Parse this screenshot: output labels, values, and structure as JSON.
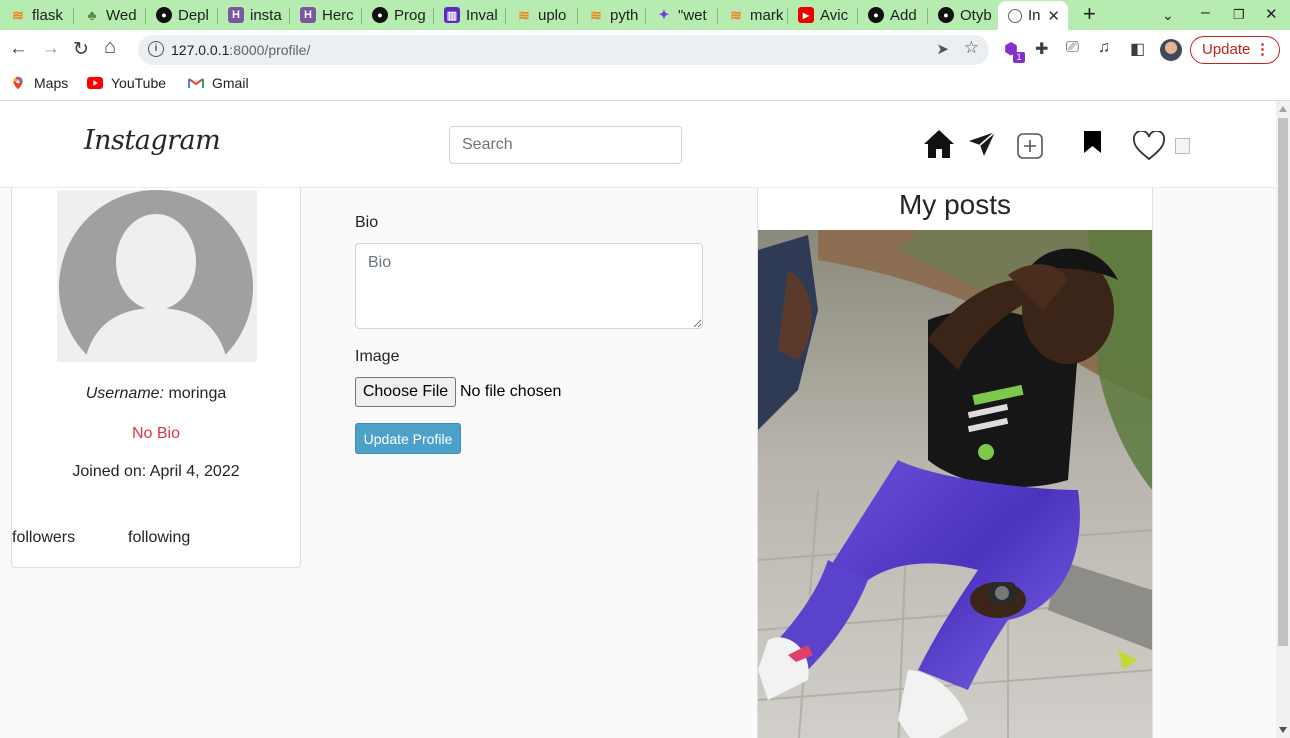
{
  "browser": {
    "tabs": [
      {
        "title": "flask",
        "icon": "stackoverflow-icon"
      },
      {
        "title": "Wed",
        "icon": "tree-icon"
      },
      {
        "title": "Depl",
        "icon": "github-icon"
      },
      {
        "title": "insta",
        "icon": "heroku-icon"
      },
      {
        "title": "Herc",
        "icon": "heroku-icon"
      },
      {
        "title": "Prog",
        "icon": "github-icon"
      },
      {
        "title": "Inval",
        "icon": "invalid-icon"
      },
      {
        "title": "uplo",
        "icon": "stackoverflow-icon"
      },
      {
        "title": "pyth",
        "icon": "stackoverflow-icon"
      },
      {
        "title": "\"wet",
        "icon": "twitter-icon"
      },
      {
        "title": "mark",
        "icon": "stackoverflow-icon"
      },
      {
        "title": "Avic",
        "icon": "youtube-icon"
      },
      {
        "title": "Add",
        "icon": "github-icon"
      },
      {
        "title": "Otyb",
        "icon": "github-icon"
      },
      {
        "title": "In",
        "icon": "globe-icon",
        "active": true
      }
    ],
    "url_host": "127.0.0.1",
    "url_path": ":8000/profile/",
    "update_label": "Update",
    "extension_badge": "1",
    "bookmarks": [
      {
        "label": "Maps",
        "icon": "maps-icon"
      },
      {
        "label": "YouTube",
        "icon": "youtube-icon"
      },
      {
        "label": "Gmail",
        "icon": "gmail-icon"
      }
    ]
  },
  "site": {
    "logo": "Instagram",
    "search_placeholder": "Search",
    "nav_icons": [
      "home-icon",
      "send-icon",
      "add-post-icon",
      "bookmark-icon",
      "heart-icon",
      "profile-image"
    ]
  },
  "profile": {
    "username_label": "Username:",
    "username": "moringa",
    "bio_status": "No Bio",
    "joined": "Joined on: April 4, 2022",
    "followers_label": "followers",
    "following_label": "following"
  },
  "form": {
    "bio_label": "Bio",
    "bio_placeholder": "Bio",
    "image_label": "Image",
    "choose_file": "Choose File",
    "no_file": "No file chosen",
    "submit": "Update Profile"
  },
  "posts": {
    "title": "My posts"
  },
  "colors": {
    "tab_strip": "#b6ecb0",
    "no_bio": "#dc3545",
    "update_button": "#4ba1c7",
    "chrome_update": "#c5221f"
  }
}
